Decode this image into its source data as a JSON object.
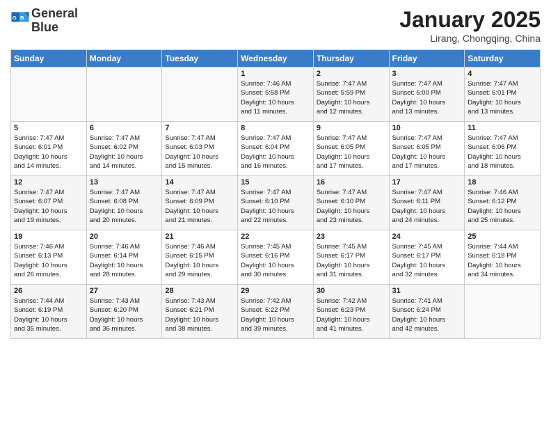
{
  "logo": {
    "line1": "General",
    "line2": "Blue"
  },
  "title": "January 2025",
  "location": "Lirang, Chongqing, China",
  "weekdays": [
    "Sunday",
    "Monday",
    "Tuesday",
    "Wednesday",
    "Thursday",
    "Friday",
    "Saturday"
  ],
  "weeks": [
    [
      {
        "day": "",
        "info": ""
      },
      {
        "day": "",
        "info": ""
      },
      {
        "day": "",
        "info": ""
      },
      {
        "day": "1",
        "info": "Sunrise: 7:46 AM\nSunset: 5:58 PM\nDaylight: 10 hours\nand 11 minutes."
      },
      {
        "day": "2",
        "info": "Sunrise: 7:47 AM\nSunset: 5:59 PM\nDaylight: 10 hours\nand 12 minutes."
      },
      {
        "day": "3",
        "info": "Sunrise: 7:47 AM\nSunset: 6:00 PM\nDaylight: 10 hours\nand 13 minutes."
      },
      {
        "day": "4",
        "info": "Sunrise: 7:47 AM\nSunset: 6:01 PM\nDaylight: 10 hours\nand 13 minutes."
      }
    ],
    [
      {
        "day": "5",
        "info": "Sunrise: 7:47 AM\nSunset: 6:01 PM\nDaylight: 10 hours\nand 14 minutes."
      },
      {
        "day": "6",
        "info": "Sunrise: 7:47 AM\nSunset: 6:02 PM\nDaylight: 10 hours\nand 14 minutes."
      },
      {
        "day": "7",
        "info": "Sunrise: 7:47 AM\nSunset: 6:03 PM\nDaylight: 10 hours\nand 15 minutes."
      },
      {
        "day": "8",
        "info": "Sunrise: 7:47 AM\nSunset: 6:04 PM\nDaylight: 10 hours\nand 16 minutes."
      },
      {
        "day": "9",
        "info": "Sunrise: 7:47 AM\nSunset: 6:05 PM\nDaylight: 10 hours\nand 17 minutes."
      },
      {
        "day": "10",
        "info": "Sunrise: 7:47 AM\nSunset: 6:05 PM\nDaylight: 10 hours\nand 17 minutes."
      },
      {
        "day": "11",
        "info": "Sunrise: 7:47 AM\nSunset: 6:06 PM\nDaylight: 10 hours\nand 18 minutes."
      }
    ],
    [
      {
        "day": "12",
        "info": "Sunrise: 7:47 AM\nSunset: 6:07 PM\nDaylight: 10 hours\nand 19 minutes."
      },
      {
        "day": "13",
        "info": "Sunrise: 7:47 AM\nSunset: 6:08 PM\nDaylight: 10 hours\nand 20 minutes."
      },
      {
        "day": "14",
        "info": "Sunrise: 7:47 AM\nSunset: 6:09 PM\nDaylight: 10 hours\nand 21 minutes."
      },
      {
        "day": "15",
        "info": "Sunrise: 7:47 AM\nSunset: 6:10 PM\nDaylight: 10 hours\nand 22 minutes."
      },
      {
        "day": "16",
        "info": "Sunrise: 7:47 AM\nSunset: 6:10 PM\nDaylight: 10 hours\nand 23 minutes."
      },
      {
        "day": "17",
        "info": "Sunrise: 7:47 AM\nSunset: 6:11 PM\nDaylight: 10 hours\nand 24 minutes."
      },
      {
        "day": "18",
        "info": "Sunrise: 7:46 AM\nSunset: 6:12 PM\nDaylight: 10 hours\nand 25 minutes."
      }
    ],
    [
      {
        "day": "19",
        "info": "Sunrise: 7:46 AM\nSunset: 6:13 PM\nDaylight: 10 hours\nand 26 minutes."
      },
      {
        "day": "20",
        "info": "Sunrise: 7:46 AM\nSunset: 6:14 PM\nDaylight: 10 hours\nand 28 minutes."
      },
      {
        "day": "21",
        "info": "Sunrise: 7:46 AM\nSunset: 6:15 PM\nDaylight: 10 hours\nand 29 minutes."
      },
      {
        "day": "22",
        "info": "Sunrise: 7:45 AM\nSunset: 6:16 PM\nDaylight: 10 hours\nand 30 minutes."
      },
      {
        "day": "23",
        "info": "Sunrise: 7:45 AM\nSunset: 6:17 PM\nDaylight: 10 hours\nand 31 minutes."
      },
      {
        "day": "24",
        "info": "Sunrise: 7:45 AM\nSunset: 6:17 PM\nDaylight: 10 hours\nand 32 minutes."
      },
      {
        "day": "25",
        "info": "Sunrise: 7:44 AM\nSunset: 6:18 PM\nDaylight: 10 hours\nand 34 minutes."
      }
    ],
    [
      {
        "day": "26",
        "info": "Sunrise: 7:44 AM\nSunset: 6:19 PM\nDaylight: 10 hours\nand 35 minutes."
      },
      {
        "day": "27",
        "info": "Sunrise: 7:43 AM\nSunset: 6:20 PM\nDaylight: 10 hours\nand 36 minutes."
      },
      {
        "day": "28",
        "info": "Sunrise: 7:43 AM\nSunset: 6:21 PM\nDaylight: 10 hours\nand 38 minutes."
      },
      {
        "day": "29",
        "info": "Sunrise: 7:42 AM\nSunset: 6:22 PM\nDaylight: 10 hours\nand 39 minutes."
      },
      {
        "day": "30",
        "info": "Sunrise: 7:42 AM\nSunset: 6:23 PM\nDaylight: 10 hours\nand 41 minutes."
      },
      {
        "day": "31",
        "info": "Sunrise: 7:41 AM\nSunset: 6:24 PM\nDaylight: 10 hours\nand 42 minutes."
      },
      {
        "day": "",
        "info": ""
      }
    ]
  ]
}
